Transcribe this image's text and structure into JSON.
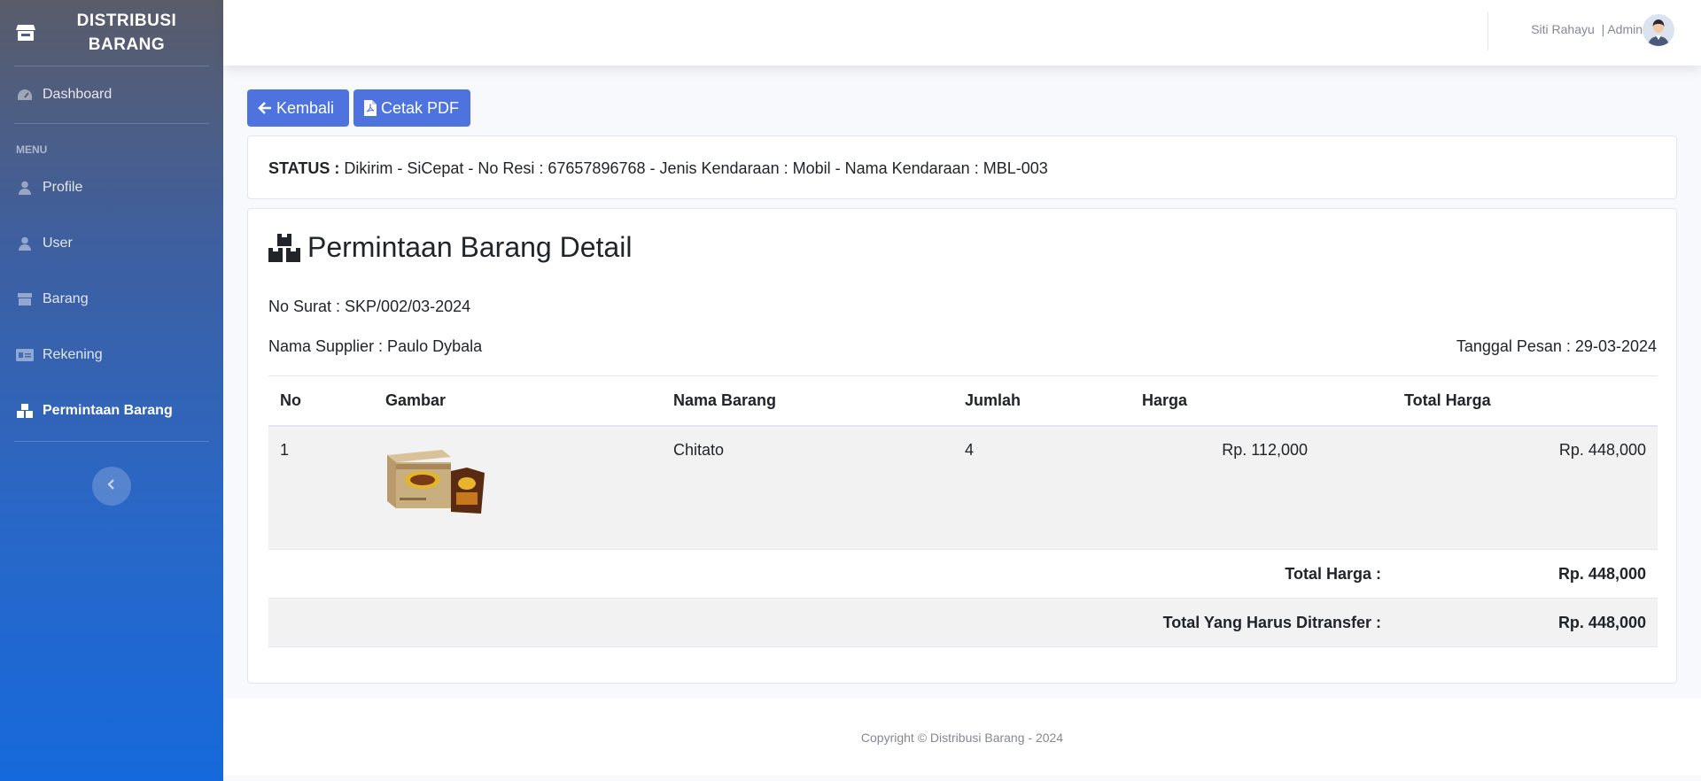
{
  "brand": {
    "line1": "DISTRIBUSI",
    "line2": "BARANG"
  },
  "sidebar": {
    "dashboard": "Dashboard",
    "heading": "MENU",
    "items": [
      {
        "label": "Profile"
      },
      {
        "label": "User"
      },
      {
        "label": "Barang"
      },
      {
        "label": "Rekening"
      },
      {
        "label": "Permintaan Barang"
      }
    ]
  },
  "topbar": {
    "user_name": "Siti Rahayu",
    "role": "| Admin"
  },
  "actions": {
    "back_label": "Kembali",
    "pdf_label": "Cetak PDF"
  },
  "status": {
    "label": "STATUS :",
    "text": "Dikirim - SiCepat - No Resi : 67657896768 - Jenis Kendaraan : Mobil - Nama Kendaraan : MBL-003"
  },
  "detail": {
    "title": "Permintaan Barang Detail",
    "no_surat": "No Surat : SKP/002/03-2024",
    "supplier": "Nama Supplier : Paulo Dybala",
    "tanggal": "Tanggal Pesan : 29-03-2024"
  },
  "table": {
    "headers": [
      "No",
      "Gambar",
      "Nama Barang",
      "Jumlah",
      "Harga",
      "Total Harga"
    ],
    "rows": [
      {
        "no": "1",
        "nama": "Chitato",
        "jumlah": "4",
        "harga": "Rp. 112,000",
        "total": "Rp. 448,000"
      }
    ],
    "total_label": "Total Harga :",
    "total_value": "Rp. 448,000",
    "transfer_label": "Total Yang Harus Ditransfer :",
    "transfer_value": "Rp. 448,000"
  },
  "footer": {
    "text": "Copyright © Distribusi Barang - 2024"
  },
  "colors": {
    "primary": "#4e73df",
    "sidebar_top": "#5a5c69",
    "sidebar_bottom": "#1669db"
  }
}
